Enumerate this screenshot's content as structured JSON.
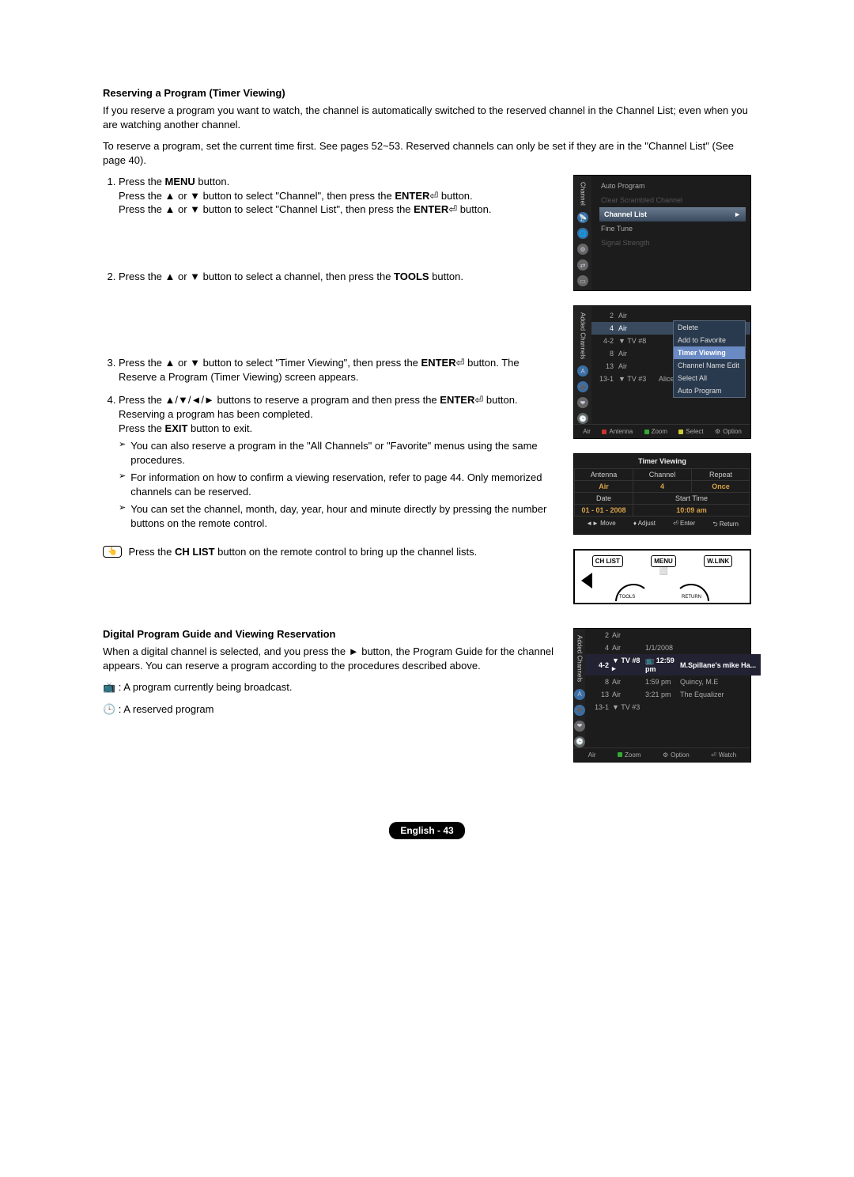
{
  "section1_title": "Reserving a Program (Timer Viewing)",
  "intro1": "If you reserve a program you want to watch, the channel is automatically switched to the reserved channel in the Channel List; even when you are watching another channel.",
  "intro2": "To reserve a program, set the current time first. See pages 52~53. Reserved channels can only be set if they are in the \"Channel List\" (See page 40).",
  "step1a": "Press the ",
  "step1a_b": "MENU",
  "step1a_c": " button.",
  "step1b": "Press the ▲ or ▼ button to select \"Channel\", then press the ",
  "step1b_b": "ENTER",
  "step1b_c": " button.",
  "step1c": "Press the ▲ or ▼ button to select \"Channel List\", then press the ",
  "step1c_b": "ENTER",
  "step1c_c": " button.",
  "step2": "Press the ▲ or ▼ button to select a channel, then press the ",
  "step2_b": "TOOLS",
  "step2_c": " button.",
  "step3": "Press the ▲ or ▼ button to select \"Timer Viewing\", then press the ",
  "step3_b": "ENTER",
  "step3_c": " button. The Reserve a Program (Timer Viewing) screen appears.",
  "step4": "Press the ▲/▼/◄/► buttons to reserve a program and then press the ",
  "step4_b": "ENTER",
  "step4_c": " button. Reserving a program has been completed.",
  "step4d": "Press the ",
  "step4d_b": "EXIT",
  "step4d_c": " button to exit.",
  "note1": "You can also reserve a program in the \"All Channels\" or \"Favorite\" menus using the same procedures.",
  "note2": "For information on how to confirm a viewing reservation, refer to page 44. Only memorized channels can be reserved.",
  "note3": "You can set the channel, month, day, year, hour and minute directly by pressing the number buttons on the remote control.",
  "tip": "Press the ",
  "tip_b": "CH LIST",
  "tip_c": " button on the remote control to bring up the channel lists.",
  "section2_title": "Digital Program Guide and Viewing Reservation",
  "sec2_intro": "When a digital channel is selected, and you press the ► button, the Program Guide for the channel appears. You can reserve a program according to the procedures described above.",
  "legend1": "📺 : A program currently being broadcast.",
  "legend2": "🕒 : A reserved program",
  "osd1": {
    "vlabel": "Channel",
    "items": [
      "Auto Program",
      "Clear Scrambled Channel",
      "Channel List",
      "Fine Tune",
      "Signal Strength"
    ],
    "highlight": "Channel List",
    "arrow": "►"
  },
  "osd2": {
    "vlabel": "Added Channels",
    "rows": [
      {
        "n": "2",
        "t": "Air"
      },
      {
        "n": "4",
        "t": "Air",
        "sel": true
      },
      {
        "n": "4-2",
        "t": "▼ TV #8"
      },
      {
        "n": "8",
        "t": "Air"
      },
      {
        "n": "13",
        "t": "Air"
      },
      {
        "n": "13-1",
        "t": "▼ TV #3",
        "extra": "Alice"
      }
    ],
    "ctx": [
      "Delete",
      "Add to Favorite",
      "Timer Viewing",
      "Channel Name Edit",
      "Select All",
      "Auto Program"
    ],
    "ctx_hl": "Timer Viewing",
    "footleft": "Air",
    "foot": [
      "Antenna",
      "Zoom",
      "Select",
      "Option"
    ]
  },
  "tv": {
    "title": "Timer Viewing",
    "r1": [
      "Antenna",
      "Channel",
      "Repeat"
    ],
    "r1v": [
      "Air",
      "4",
      "Once"
    ],
    "r2": [
      "Date",
      "Start Time"
    ],
    "r2v": [
      "01 - 01 - 2008",
      "10:09 am"
    ],
    "foot": [
      "◄► Move",
      "♦ Adjust",
      "⏎ Enter",
      "⮌ Return"
    ]
  },
  "remote": {
    "b1": "CH LIST",
    "b2": "MENU",
    "b3": "W.LINK",
    "lab1": "TOOLS",
    "lab2": "RETURN"
  },
  "osd3": {
    "vlabel": "Added Channels",
    "top": [
      "2",
      "Air"
    ],
    "topb": [
      "4",
      "Air",
      "1/1/2008"
    ],
    "rows": [
      {
        "c1": "4-2",
        "c2": "▼ TV #8 ▸",
        "c3": "📺 12:59 pm",
        "c4": "M.Spillane's mike Ha...",
        "sel": true
      },
      {
        "c1": "8",
        "c2": "Air",
        "c3": "1:59 pm",
        "c4": "Quincy, M.E"
      },
      {
        "c1": "13",
        "c2": "Air",
        "c3": "3:21 pm",
        "c4": "The Equalizer"
      },
      {
        "c1": "13-1",
        "c2": "▼ TV #3",
        "c3": "",
        "c4": ""
      }
    ],
    "footleft": "Air",
    "foot": [
      "Zoom",
      "Option",
      "Watch"
    ]
  },
  "pagenum": "English - 43"
}
